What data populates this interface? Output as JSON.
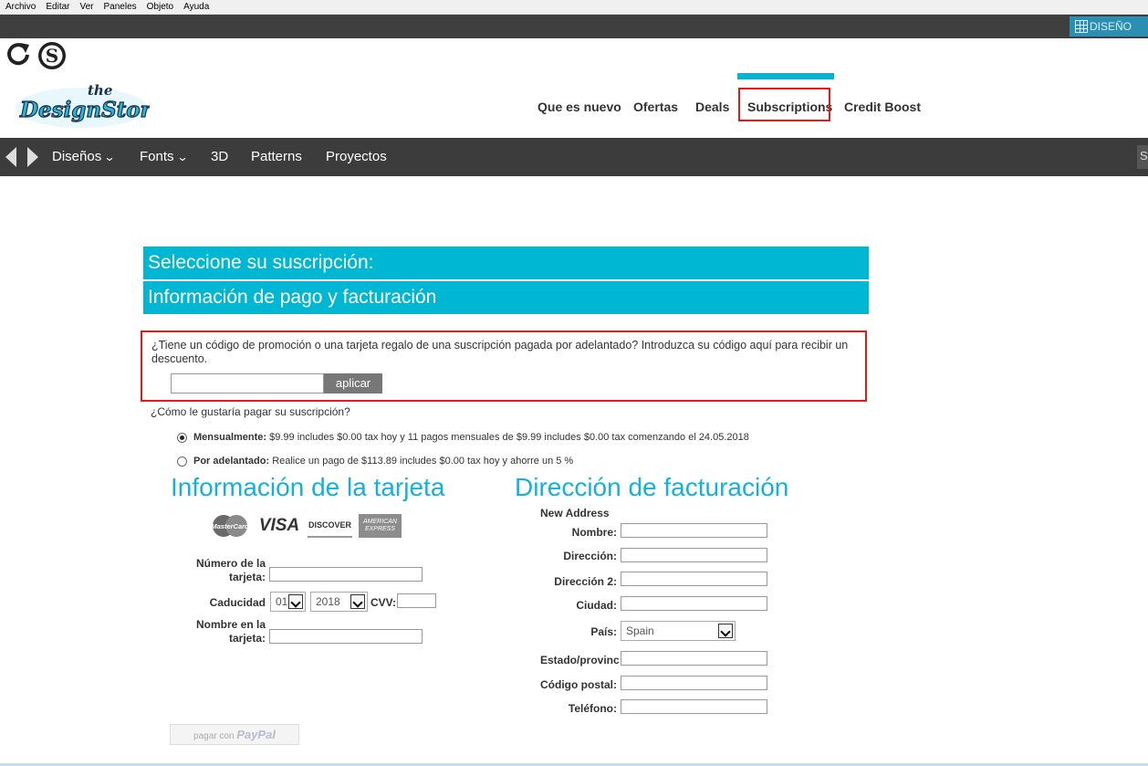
{
  "menubar": {
    "items": [
      "Archivo",
      "Editar",
      "Ver",
      "Paneles",
      "Objeto",
      "Ayuda"
    ]
  },
  "darkbar": {
    "tab_label": "DISEÑO"
  },
  "logo": {
    "the": "the",
    "brand": "DesignStore"
  },
  "topnav": {
    "items": [
      "Que es nuevo",
      "Ofertas",
      "Deals",
      "Subscriptions",
      "Credit Boost"
    ]
  },
  "navbar": {
    "items": [
      "Diseños",
      "Fonts",
      "3D",
      "Patterns",
      "Proyectos"
    ],
    "search_stub": "S"
  },
  "bands": {
    "subscription": "Seleccione su suscripción:",
    "payment": "Información de pago y facturación"
  },
  "promo": {
    "text": "¿Tiene un código de promoción o una tarjeta regalo de una suscripción pagada por adelantado? Introduzca su código aquí para recibir un descuento.",
    "input_value": "",
    "button_label": "aplicar"
  },
  "payment_question": "¿Cómo le gustaría pagar su suscripción?",
  "options": {
    "monthly": {
      "label": "Mensualmente:",
      "detail": "$9.99 includes $0.00 tax hoy y 11 pagos mensuales de $9.99 includes $0.00 tax  comenzando el 24.05.2018",
      "selected": true
    },
    "upfront": {
      "label": "Por adelantado:",
      "detail": "Realice un pago de $113.89 includes $0.00 tax  hoy y ahorre un 5 %",
      "selected": false
    }
  },
  "card_section": {
    "title": "Información de la tarjeta",
    "logos": [
      "MasterCard",
      "VISA",
      "DISCOVER",
      "AMERICAN EXPRESS"
    ],
    "number_label_1": "Número de la",
    "number_label_2": "tarjeta:",
    "expiry_label": "Caducidad",
    "expiry_month": "01",
    "expiry_year": "2018",
    "cvv_label": "CVV:",
    "name_label_1": "Nombre en la",
    "name_label_2": "tarjeta:"
  },
  "billing_section": {
    "title": "Dirección de facturación",
    "new_address": "New Address",
    "fields": {
      "name": "Nombre:",
      "address": "Dirección:",
      "address2": "Dirección 2:",
      "city": "Ciudad:",
      "country": "País:",
      "state": "Estado/provinc",
      "postal": "Código postal:",
      "phone": "Teléfono:"
    },
    "country_value": "Spain"
  },
  "paypal": {
    "prefix": "pagar con",
    "brand": "PayPal"
  },
  "colors": {
    "accent": "#00b7d3",
    "highlight": "#e01b1b",
    "nav_dark": "#3c3c3c"
  }
}
